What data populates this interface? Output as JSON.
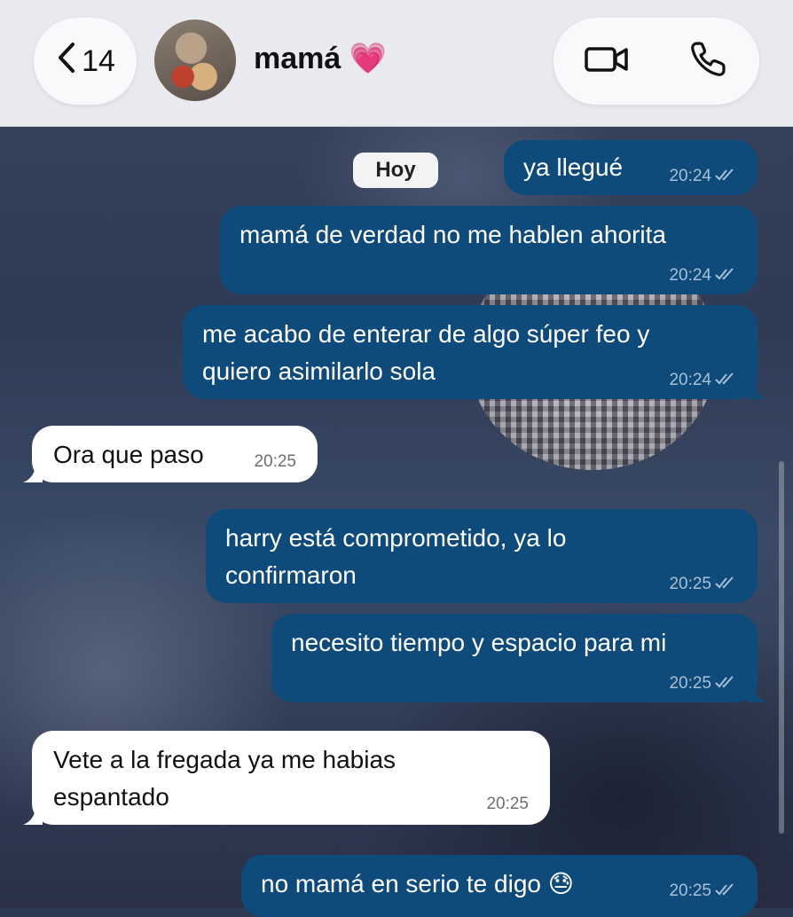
{
  "header": {
    "back_count": "14",
    "contact_name": "mamá 💗"
  },
  "chat": {
    "date_chip": "Hoy",
    "messages": [
      {
        "dir": "out",
        "lines": [
          "ya llegué"
        ],
        "time": "20:24"
      },
      {
        "dir": "out",
        "lines": [
          "mamá de verdad no me hablen ahorita"
        ],
        "time": "20:24"
      },
      {
        "dir": "out",
        "lines": [
          "me acabo de enterar de algo súper feo y",
          "quiero asimilarlo sola"
        ],
        "time": "20:24"
      },
      {
        "dir": "in",
        "lines": [
          "Ora que paso"
        ],
        "time": "20:25"
      },
      {
        "dir": "out",
        "lines": [
          "harry está comprometido, ya lo",
          "confirmaron"
        ],
        "time": "20:25"
      },
      {
        "dir": "out",
        "lines": [
          "necesito tiempo y espacio para mi"
        ],
        "time": "20:25"
      },
      {
        "dir": "in",
        "lines": [
          "Vete a la fregada ya me habias",
          "espantado"
        ],
        "time": "20:25"
      },
      {
        "dir": "out",
        "lines": [
          "no mamá en serio te digo 😓"
        ],
        "time": "20:25"
      }
    ]
  },
  "colors": {
    "outgoing_bubble": "#0e4a7a",
    "incoming_bubble": "#ffffff",
    "header_bg": "#e9eaf0"
  },
  "icons": {
    "back": "chevron-left-icon",
    "video": "video-camera-icon",
    "phone": "phone-icon",
    "read": "double-check-icon"
  }
}
